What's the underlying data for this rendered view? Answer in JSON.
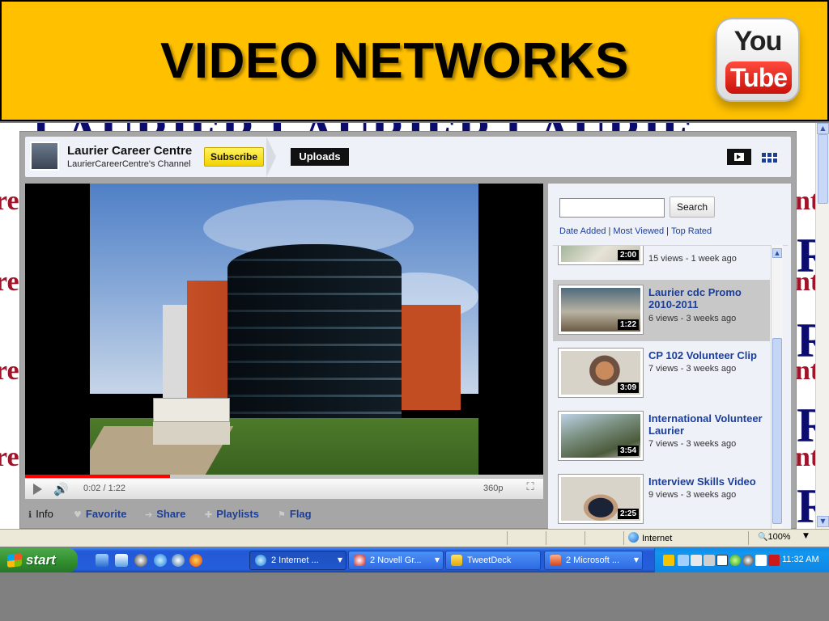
{
  "slide": {
    "title": "VIDEO NETWORKS",
    "logo": {
      "you": "You",
      "tube": "Tube"
    }
  },
  "channel": {
    "name": "Laurier Career Centre",
    "subtitle": "LaurierCareerCentre's Channel",
    "subscribe_label": "Subscribe",
    "uploads_label": "Uploads"
  },
  "player": {
    "time": "0:02 / 1:22",
    "quality": "360p",
    "progress_fraction": 0.28
  },
  "tabs": [
    {
      "label": "Info",
      "icon": "info-icon"
    },
    {
      "label": "Favorite",
      "icon": "heart-icon"
    },
    {
      "label": "Share",
      "icon": "share-arrow-icon"
    },
    {
      "label": "Playlists",
      "icon": "plus-icon"
    },
    {
      "label": "Flag",
      "icon": "flag-icon"
    }
  ],
  "side": {
    "search_label": "Search",
    "sort": [
      "Date Added",
      "Most Viewed",
      "Top Rated"
    ],
    "videos": [
      {
        "title": "",
        "meta": "15 views - 1 week ago",
        "duration": "2:00"
      },
      {
        "title": "Laurier cdc Promo 2010-2011",
        "meta": "6 views - 3 weeks ago",
        "duration": "1:22"
      },
      {
        "title": "CP 102 Volunteer Clip",
        "meta": "7 views - 3 weeks ago",
        "duration": "3:09"
      },
      {
        "title": "International Volunteer Laurier",
        "meta": "7 views - 3 weeks ago",
        "duration": "3:54"
      },
      {
        "title": "Interview Skills Video",
        "meta": "9 views - 3 weeks ago",
        "duration": "2:25"
      }
    ]
  },
  "statusbar": {
    "zone": "Internet",
    "zoom": "100%"
  },
  "taskbar": {
    "start_label": "start",
    "tasks": [
      {
        "label": "2 Internet ...",
        "active": true
      },
      {
        "label": "2 Novell Gr...",
        "active": false
      },
      {
        "label": "TweetDeck",
        "active": false
      },
      {
        "label": "2 Microsoft ...",
        "active": false
      }
    ],
    "clock": "11:32 AM"
  },
  "colors": {
    "banner": "#ffc000",
    "link": "#1a3e9c",
    "taskbar": "#245edb",
    "subscribe": "#f2d300"
  }
}
